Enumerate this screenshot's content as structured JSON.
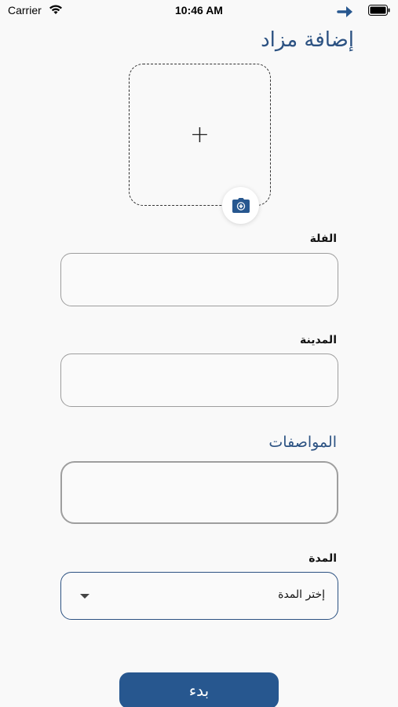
{
  "status_bar": {
    "carrier": "Carrier",
    "time": "10:46 AM"
  },
  "header": {
    "title": "إضافة مزاد"
  },
  "image_picker": {
    "plus": "+"
  },
  "form": {
    "field_villa": {
      "label": "الفلة",
      "value": ""
    },
    "field_city": {
      "label": "المدينة",
      "value": ""
    },
    "field_specs": {
      "label": "المواصفات",
      "value": ""
    },
    "field_duration": {
      "label": "المدة",
      "selected": "إختر المدة"
    }
  },
  "submit": {
    "label": "بدء"
  },
  "colors": {
    "accent": "#2c5282",
    "button": "#27578f",
    "border": "#9e9e9e"
  }
}
